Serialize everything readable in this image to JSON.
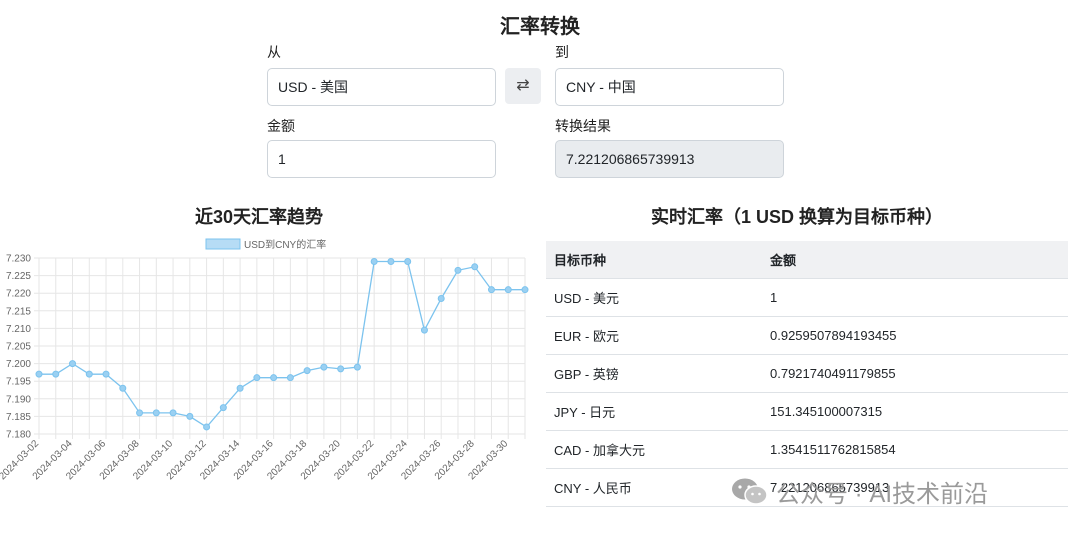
{
  "title": "汇率转换",
  "from": {
    "label": "从",
    "value": "USD - 美国"
  },
  "to": {
    "label": "到",
    "value": "CNY - 中国"
  },
  "swap_icon": "⇄",
  "amount": {
    "label": "金额",
    "value": "1"
  },
  "result": {
    "label": "转换结果",
    "value": "7.221206865739913"
  },
  "chart_section_title": "近30天汇率趋势",
  "table_section_title": "实时汇率（1 USD 换算为目标币种）",
  "table": {
    "headers": [
      "目标币种",
      "金额"
    ],
    "rows": [
      [
        "USD - 美元",
        "1"
      ],
      [
        "EUR - 欧元",
        "0.9259507894193455"
      ],
      [
        "GBP - 英镑",
        "0.7921740491179855"
      ],
      [
        "JPY - 日元",
        "151.345100007315"
      ],
      [
        "CAD - 加拿大元",
        "1.3541511762815854"
      ],
      [
        "CNY - 人民币",
        "7.221206865739913"
      ]
    ]
  },
  "watermark": "公众号 · AI技术前沿",
  "chart_data": {
    "type": "line",
    "x": [
      "2024-03-02",
      "2024-03-03",
      "2024-03-04",
      "2024-03-05",
      "2024-03-06",
      "2024-03-07",
      "2024-03-08",
      "2024-03-09",
      "2024-03-10",
      "2024-03-11",
      "2024-03-12",
      "2024-03-13",
      "2024-03-14",
      "2024-03-15",
      "2024-03-16",
      "2024-03-17",
      "2024-03-18",
      "2024-03-19",
      "2024-03-20",
      "2024-03-21",
      "2024-03-22",
      "2024-03-23",
      "2024-03-24",
      "2024-03-25",
      "2024-03-26",
      "2024-03-27",
      "2024-03-28",
      "2024-03-29",
      "2024-03-30",
      "2024-03-31"
    ],
    "x_tick_labels": [
      "2024-03-02",
      "2024-03-04",
      "2024-03-06",
      "2024-03-08",
      "2024-03-10",
      "2024-03-12",
      "2024-03-14",
      "2024-03-16",
      "2024-03-18",
      "2024-03-20",
      "2024-03-22",
      "2024-03-24",
      "2024-03-26",
      "2024-03-28",
      "2024-03-30"
    ],
    "series": [
      {
        "name": "USD到CNY的汇率",
        "color": "#7cc3ee",
        "values": [
          7.197,
          7.197,
          7.2,
          7.197,
          7.197,
          7.193,
          7.186,
          7.186,
          7.186,
          7.185,
          7.182,
          7.1875,
          7.193,
          7.196,
          7.196,
          7.196,
          7.198,
          7.199,
          7.1985,
          7.199,
          7.229,
          7.229,
          7.229,
          7.2095,
          7.2185,
          7.2265,
          7.2275,
          7.221,
          7.221,
          7.221
        ]
      }
    ],
    "ylim": [
      7.18,
      7.23
    ],
    "y_ticks": [
      "7.180",
      "7.185",
      "7.190",
      "7.195",
      "7.200",
      "7.205",
      "7.210",
      "7.215",
      "7.220",
      "7.225",
      "7.230"
    ],
    "legend": "top-center",
    "grid": true,
    "title": "",
    "xlabel": "",
    "ylabel": ""
  }
}
